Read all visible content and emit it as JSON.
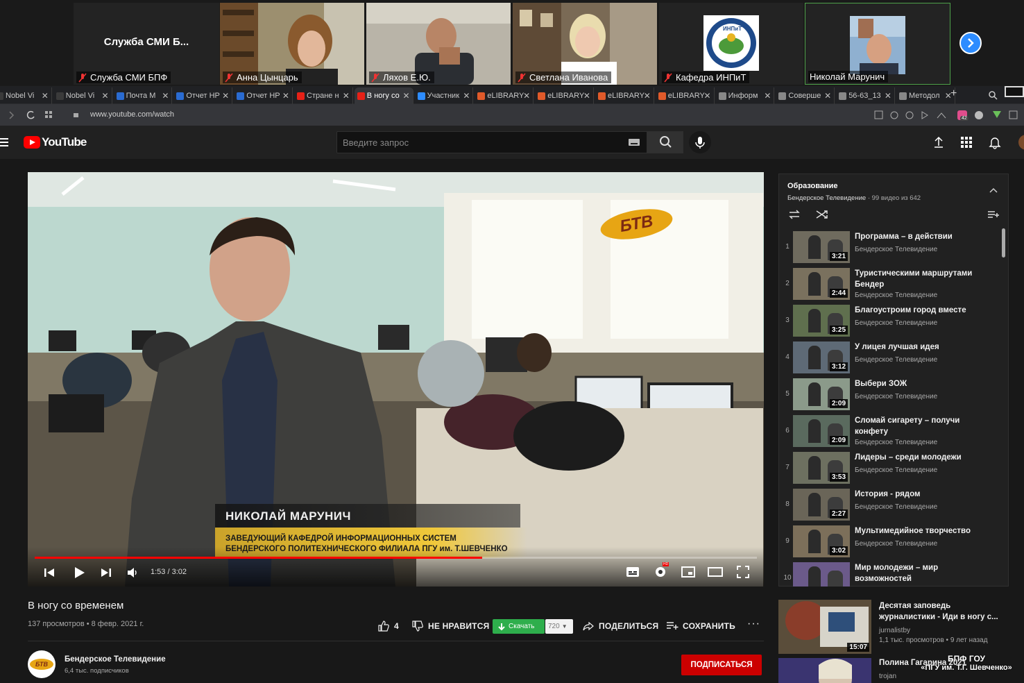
{
  "conference": {
    "tiles": [
      {
        "name": "Служба СМИ БПФ",
        "display": "Служба  СМИ  Б..."
      },
      {
        "name": "Анна Цынцарь"
      },
      {
        "name": "Ляхов Е.Ю."
      },
      {
        "name": "Светлана Иванова"
      },
      {
        "name": "Кафедра ИНПиТ",
        "logo_text": "ИНПиТ"
      },
      {
        "name": "Николай Марунич"
      }
    ]
  },
  "browser": {
    "tabs": [
      {
        "label": "Nobel Vi",
        "fav": "#3a3a3a"
      },
      {
        "label": "Nobel Vi",
        "fav": "#3a3a3a"
      },
      {
        "label": "Почта М",
        "fav": "#2a6bd1"
      },
      {
        "label": "Отчет НР",
        "fav": "#2a6bd1"
      },
      {
        "label": "Отчет НР",
        "fav": "#2a6bd1"
      },
      {
        "label": "Стране н",
        "fav": "#e62117"
      },
      {
        "label": "В ногу со",
        "fav": "#e62117",
        "active": true
      },
      {
        "label": "Участник",
        "fav": "#2d8cff"
      },
      {
        "label": "eLIBRARY",
        "fav": "#e05a2a"
      },
      {
        "label": "eLIBRARY",
        "fav": "#e05a2a"
      },
      {
        "label": "eLIBRARY",
        "fav": "#e05a2a"
      },
      {
        "label": "eLIBRARY",
        "fav": "#e05a2a"
      },
      {
        "label": "Информ",
        "fav": "#888888"
      },
      {
        "label": "Соверше",
        "fav": "#888888"
      },
      {
        "label": "56-63_13",
        "fav": "#888888"
      },
      {
        "label": "Методол",
        "fav": "#888888"
      }
    ],
    "url": "www.youtube.com/watch",
    "ext_badge": "42"
  },
  "youtube": {
    "logo": "YouTube",
    "search_placeholder": "Введите запрос",
    "video": {
      "overlay_name": "НИКОЛАЙ МАРУНИЧ",
      "overlay_line1": "ЗАВЕДУЮЩИЙ КАФЕДРОЙ ИНФОРМАЦИОННЫХ СИСТЕМ",
      "overlay_line2": "БЕНДЕРСКОГО ПОЛИТЕХНИЧЕСКОГО ФИЛИАЛА ПГУ им. Т.ШЕВЧЕНКО",
      "channel_logo": "БТВ",
      "time": "1:53 / 3:02",
      "progress": 0.62,
      "hd_badge": "HD"
    },
    "title": "В ногу со временем",
    "meta": "137 просмотров • 8 февр. 2021 г.",
    "likes": "4",
    "dislike_label": "НЕ НРАВИТСЯ",
    "download_label": "Скачать",
    "quality": "720",
    "share_label": "ПОДЕЛИТЬСЯ",
    "save_label": "СОХРАНИТЬ",
    "channel": {
      "name": "Бендерское Телевидение",
      "subs": "6,4 тыс. подписчиков",
      "avatar_text": "БТВ"
    },
    "subscribe_label": "ПОДПИСАТЬСЯ",
    "playlist": {
      "title": "Образование",
      "owner": "Бендерское Телевидение",
      "count": " · 99 видео из 642",
      "items": [
        {
          "idx": "1",
          "title": "Программа – в действии",
          "channel": "Бендерское Телевидение",
          "dur": "3:21"
        },
        {
          "idx": "2",
          "title": "Туристическими маршрутами Бендер",
          "channel": "Бендерское Телевидение",
          "dur": "2:44"
        },
        {
          "idx": "3",
          "title": "Благоустроим город вместе",
          "channel": "Бендерское Телевидение",
          "dur": "3:25"
        },
        {
          "idx": "4",
          "title": "У лицея лучшая идея",
          "channel": "Бендерское Телевидение",
          "dur": "3:12"
        },
        {
          "idx": "5",
          "title": "Выбери ЗОЖ",
          "channel": "Бендерское Телевидение",
          "dur": "2:09"
        },
        {
          "idx": "6",
          "title": "Сломай сигарету – получи конфету",
          "channel": "Бендерское Телевидение",
          "dur": "2:09"
        },
        {
          "idx": "7",
          "title": "Лидеры – среди молодежи",
          "channel": "Бендерское Телевидение",
          "dur": "3:53"
        },
        {
          "idx": "8",
          "title": "История - рядом",
          "channel": "Бендерское Телевидение",
          "dur": "2:27"
        },
        {
          "idx": "9",
          "title": "Мультимедийное творчество",
          "channel": "Бендерское Телевидение",
          "dur": "3:02"
        },
        {
          "idx": "10",
          "title": "Мир молодежи – мир возможностей",
          "channel": "",
          "dur": ""
        }
      ]
    },
    "related": [
      {
        "title": "Десятая заповедь журналистики - Иди в ногу с...",
        "channel": "jurnalistby",
        "meta": "1,1 тыс. просмотров • 9 лет назад",
        "dur": "15:07"
      },
      {
        "title": "Полина Гагарина 2021",
        "channel": "trojan",
        "meta": "",
        "dur": ""
      }
    ]
  },
  "watermark": {
    "line1": "БПФ ГОУ",
    "line2": "«ПГУ им. Т.Г. Шевченко»"
  }
}
